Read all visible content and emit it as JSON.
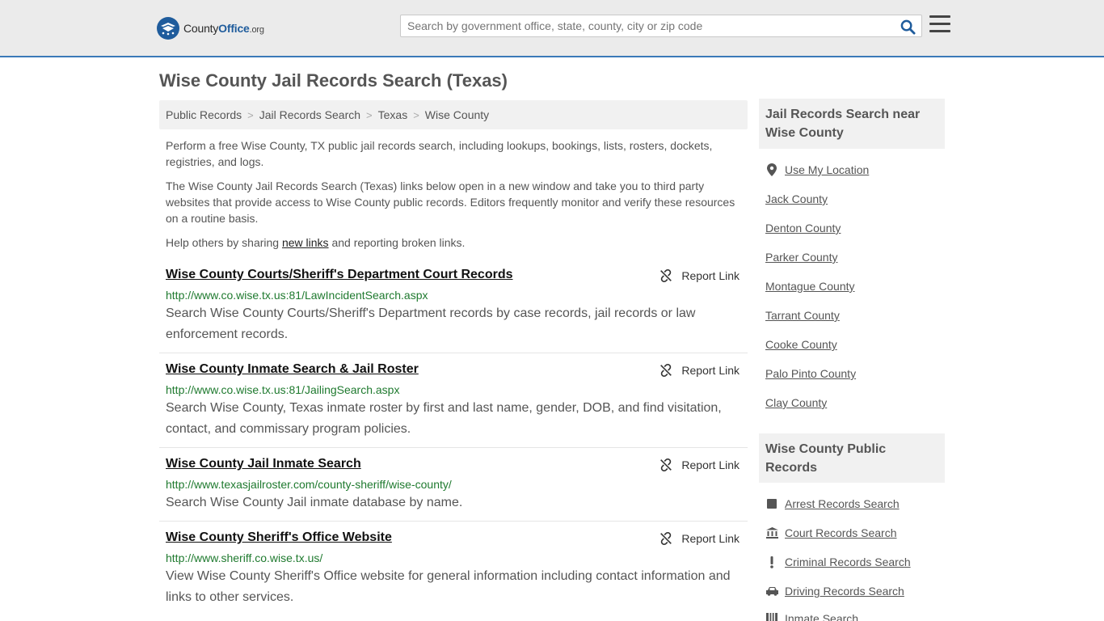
{
  "header": {
    "logo": {
      "part1": "County",
      "part2": "Office",
      "part3": ".org"
    },
    "search_placeholder": "Search by government office, state, county, city or zip code",
    "search_value": ""
  },
  "page": {
    "title": "Wise County Jail Records Search (Texas)"
  },
  "breadcrumb": [
    "Public Records",
    "Jail Records Search",
    "Texas",
    "Wise County"
  ],
  "intro": {
    "p1": "Perform a free Wise County, TX public jail records search, including lookups, bookings, lists, rosters, dockets, registries, and logs.",
    "p2": "The Wise County Jail Records Search (Texas) links below open in a new window and take you to third party websites that provide access to Wise County public records. Editors frequently monitor and verify these resources on a routine basis.",
    "p3_before": "Help others by sharing ",
    "p3_link": "new links",
    "p3_after": " and reporting broken links."
  },
  "report_label": "Report Link",
  "results": [
    {
      "title": "Wise County Courts/Sheriff's Department Court Records",
      "url": "http://www.co.wise.tx.us:81/LawIncidentSearch.aspx",
      "desc": "Search Wise County Courts/Sheriff's Department records by case records, jail records or law enforcement records."
    },
    {
      "title": "Wise County Inmate Search & Jail Roster",
      "url": "http://www.co.wise.tx.us:81/JailingSearch.aspx",
      "desc": "Search Wise County, Texas inmate roster by first and last name, gender, DOB, and find visitation, contact, and commissary program policies."
    },
    {
      "title": "Wise County Jail Inmate Search",
      "url": "http://www.texasjailroster.com/county-sheriff/wise-county/",
      "desc": "Search Wise County Jail inmate database by name."
    },
    {
      "title": "Wise County Sheriff's Office Website",
      "url": "http://www.sheriff.co.wise.tx.us/",
      "desc": "View Wise County Sheriff's Office website for general information including contact information and links to other services."
    }
  ],
  "sidebar": {
    "nearby_heading": "Jail Records Search near Wise County",
    "use_location": "Use My Location",
    "nearby": [
      "Jack County",
      "Denton County",
      "Parker County",
      "Montague County",
      "Tarrant County",
      "Cooke County",
      "Palo Pinto County",
      "Clay County"
    ],
    "public_heading": "Wise County Public Records",
    "public_links": [
      {
        "label": "Arrest Records Search",
        "icon": "arrest-icon"
      },
      {
        "label": "Court Records Search",
        "icon": "courthouse-icon"
      },
      {
        "label": "Criminal Records Search",
        "icon": "exclamation-icon"
      },
      {
        "label": "Driving Records Search",
        "icon": "car-icon"
      },
      {
        "label": "Inmate Search",
        "icon": "inmate-icon"
      }
    ]
  },
  "colors": {
    "accent": "#3b79b8",
    "url_green": "#1f7a2f",
    "logo_blue": "#1f5c9c"
  }
}
